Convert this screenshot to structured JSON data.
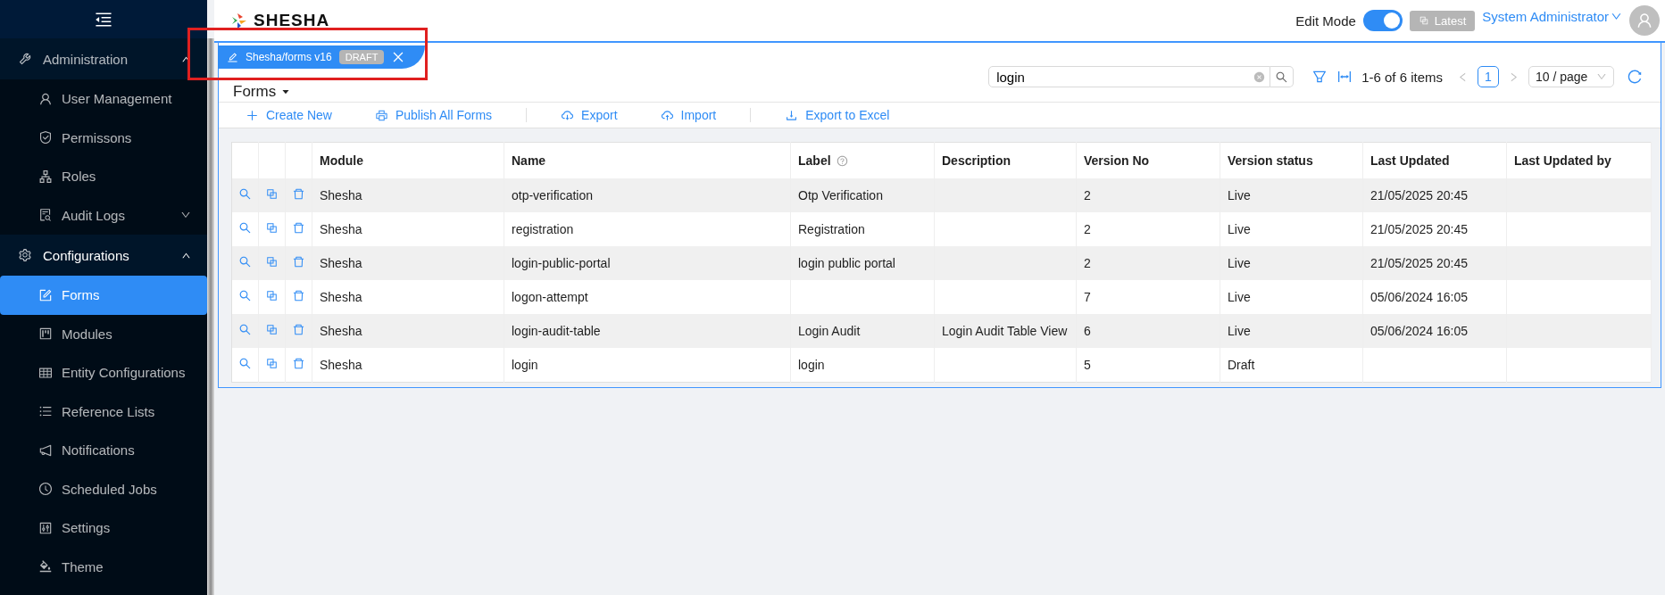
{
  "sidebar": {
    "groups": [
      {
        "label": "Administration",
        "expanded": true,
        "children": [
          {
            "label": "User Management",
            "kind": "link",
            "selected": false
          },
          {
            "label": "Permissons",
            "kind": "link",
            "selected": false
          },
          {
            "label": "Roles",
            "kind": "link",
            "selected": false
          },
          {
            "label": "Audit Logs",
            "kind": "submenu",
            "selected": false,
            "expanded": false
          }
        ]
      },
      {
        "label": "Configurations",
        "expanded": true,
        "children": [
          {
            "label": "Forms",
            "kind": "link",
            "selected": true
          },
          {
            "label": "Modules",
            "kind": "link",
            "selected": false
          },
          {
            "label": "Entity Configurations",
            "kind": "link",
            "selected": false
          },
          {
            "label": "Reference Lists",
            "kind": "link",
            "selected": false
          },
          {
            "label": "Notifications",
            "kind": "link",
            "selected": false
          },
          {
            "label": "Scheduled Jobs",
            "kind": "link",
            "selected": false
          },
          {
            "label": "Settings",
            "kind": "link",
            "selected": false
          },
          {
            "label": "Theme",
            "kind": "link",
            "selected": false
          }
        ]
      }
    ]
  },
  "header": {
    "logo": "SHESHA",
    "edit_mode": {
      "label": "Edit Mode",
      "on": true
    },
    "latest_button": "Latest",
    "user": "System Administrator"
  },
  "form_tab": {
    "title": "Shesha/forms v16",
    "badge": "DRAFT"
  },
  "page_title": "Forms",
  "search": {
    "value": "login"
  },
  "pager": {
    "summary": "1-6 of 6 items",
    "pages": [
      {
        "label": "1",
        "selected": true
      }
    ],
    "page_size": "10 / page"
  },
  "toolbar": [
    {
      "label": "Create New"
    },
    {
      "label": "Publish All Forms"
    },
    {
      "label": "Export",
      "divider_before": true
    },
    {
      "label": "Import"
    },
    {
      "label": "Export to Excel",
      "divider_before": true
    }
  ],
  "table": {
    "columns": [
      {
        "label": "Module"
      },
      {
        "label": "Name"
      },
      {
        "label": "Label",
        "help": true
      },
      {
        "label": "Description"
      },
      {
        "label": "Version No"
      },
      {
        "label": "Version status"
      },
      {
        "label": "Last Updated"
      },
      {
        "label": "Last Updated by"
      }
    ],
    "rows": [
      [
        "Shesha",
        "otp-verification",
        "Otp Verification",
        "",
        "2",
        "Live",
        "21/05/2025 20:45",
        ""
      ],
      [
        "Shesha",
        "registration",
        "Registration",
        "",
        "2",
        "Live",
        "21/05/2025 20:45",
        ""
      ],
      [
        "Shesha",
        "login-public-portal",
        "login public portal",
        "",
        "2",
        "Live",
        "21/05/2025 20:45",
        ""
      ],
      [
        "Shesha",
        "logon-attempt",
        "",
        "",
        "7",
        "Live",
        "05/06/2024 16:05",
        ""
      ],
      [
        "Shesha",
        "login-audit-table",
        "Login Audit",
        "Login Audit Table View",
        "6",
        "Live",
        "05/06/2024 16:05",
        ""
      ],
      [
        "Shesha",
        "login",
        "login",
        "",
        "5",
        "Draft",
        "",
        ""
      ]
    ]
  }
}
